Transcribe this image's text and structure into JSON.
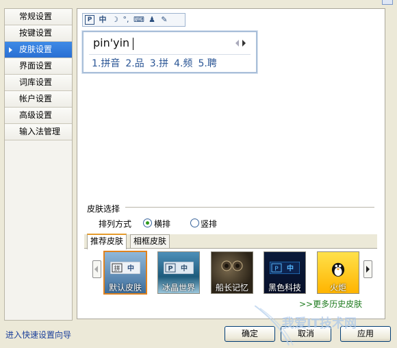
{
  "sidebar": {
    "items": [
      {
        "label": "常规设置",
        "selected": false
      },
      {
        "label": "按键设置",
        "selected": false
      },
      {
        "label": "皮肤设置",
        "selected": true
      },
      {
        "label": "界面设置",
        "selected": false
      },
      {
        "label": "词库设置",
        "selected": false
      },
      {
        "label": "帐户设置",
        "selected": false
      },
      {
        "label": "高级设置",
        "selected": false
      },
      {
        "label": "输入法管理",
        "selected": false
      }
    ]
  },
  "preview": {
    "toolbar": {
      "logo": "P",
      "mode": "中"
    },
    "composition": "pin'yin",
    "candidates": [
      "1.拼音",
      "2.品",
      "3.拼",
      "4.频",
      "5.聘"
    ]
  },
  "skin": {
    "section_title": "皮肤选择",
    "layout_label": "排列方式",
    "layout_options": [
      {
        "label": "横排",
        "checked": true
      },
      {
        "label": "竖排",
        "checked": false
      }
    ],
    "tabs": [
      {
        "label": "推荐皮肤",
        "active": true
      },
      {
        "label": "相框皮肤",
        "active": false
      }
    ],
    "thumbnails": [
      {
        "caption": "默认皮肤",
        "selected": true
      },
      {
        "caption": "冰晶世界",
        "selected": false
      },
      {
        "caption": "船长记忆",
        "selected": false
      },
      {
        "caption": "黑色科技",
        "selected": false
      },
      {
        "caption": "火炬",
        "selected": false
      }
    ],
    "more_link": ">>更多历史皮肤"
  },
  "footer": {
    "quick_setup_link": "进入快速设置向导",
    "ok_label": "确定",
    "cancel_label": "取消",
    "apply_label": "应用"
  },
  "watermark": {
    "text": "我爱IT技术网"
  },
  "colors": {
    "accent": "#2a6fd3",
    "selection_orange": "#e0821e",
    "link_blue": "#1a3f9a",
    "link_green": "#1c7a1c"
  }
}
